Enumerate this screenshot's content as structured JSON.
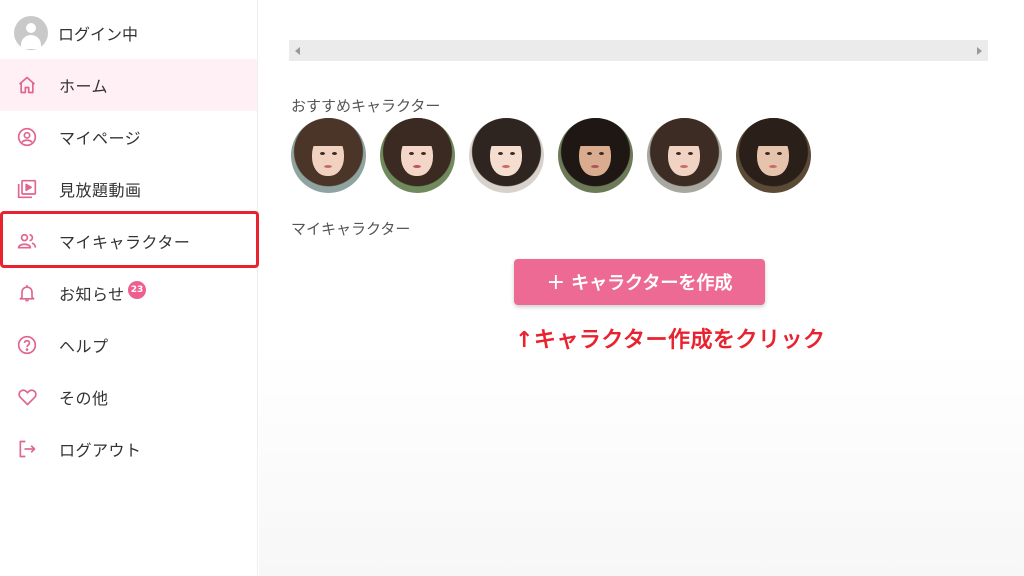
{
  "user": {
    "label": "ログイン中"
  },
  "nav": [
    {
      "label": "ホーム",
      "icon": "home-icon",
      "active": true
    },
    {
      "label": "マイページ",
      "icon": "user-circle-icon"
    },
    {
      "label": "見放題動画",
      "icon": "video-library-icon"
    },
    {
      "label": "マイキャラクター",
      "icon": "people-icon"
    },
    {
      "label": "お知らせ",
      "icon": "bell-icon",
      "badge": "23"
    },
    {
      "label": "ヘルプ",
      "icon": "help-circle-icon"
    },
    {
      "label": "その他",
      "icon": "heart-icon"
    },
    {
      "label": "ログアウト",
      "icon": "logout-icon"
    }
  ],
  "main": {
    "recommended_title": "おすすめキャラクター",
    "my_characters_title": "マイキャラクター",
    "create_button": {
      "plus": "+",
      "label": "キャラクターを作成"
    },
    "instruction": "↑キャラクター作成をクリック"
  },
  "colors": {
    "accent": "#ec6a93",
    "icon": "#e0668d",
    "highlight": "#e8232f",
    "active_bg": "#fff0f5"
  }
}
